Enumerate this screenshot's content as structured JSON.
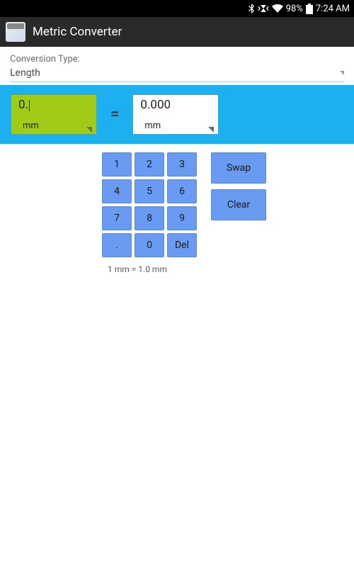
{
  "status": {
    "percent_text": "98%",
    "time": "7:24 AM"
  },
  "app": {
    "title": "Metric Converter"
  },
  "conversion": {
    "type_label": "Conversion Type:",
    "type_value": "Length",
    "input_value": "0.",
    "input_unit": "mm",
    "equals": "=",
    "output_value": "0.000",
    "output_unit": "mm"
  },
  "keypad": {
    "k1": "1",
    "k2": "2",
    "k3": "3",
    "k4": "4",
    "k5": "5",
    "k6": "6",
    "k7": "7",
    "k8": "8",
    "k9": "9",
    "kdot": ".",
    "k0": "0",
    "kdel": "Del"
  },
  "actions": {
    "swap": "Swap",
    "clear": "Clear"
  },
  "ratio_text": "1 mm = 1.0 mm"
}
